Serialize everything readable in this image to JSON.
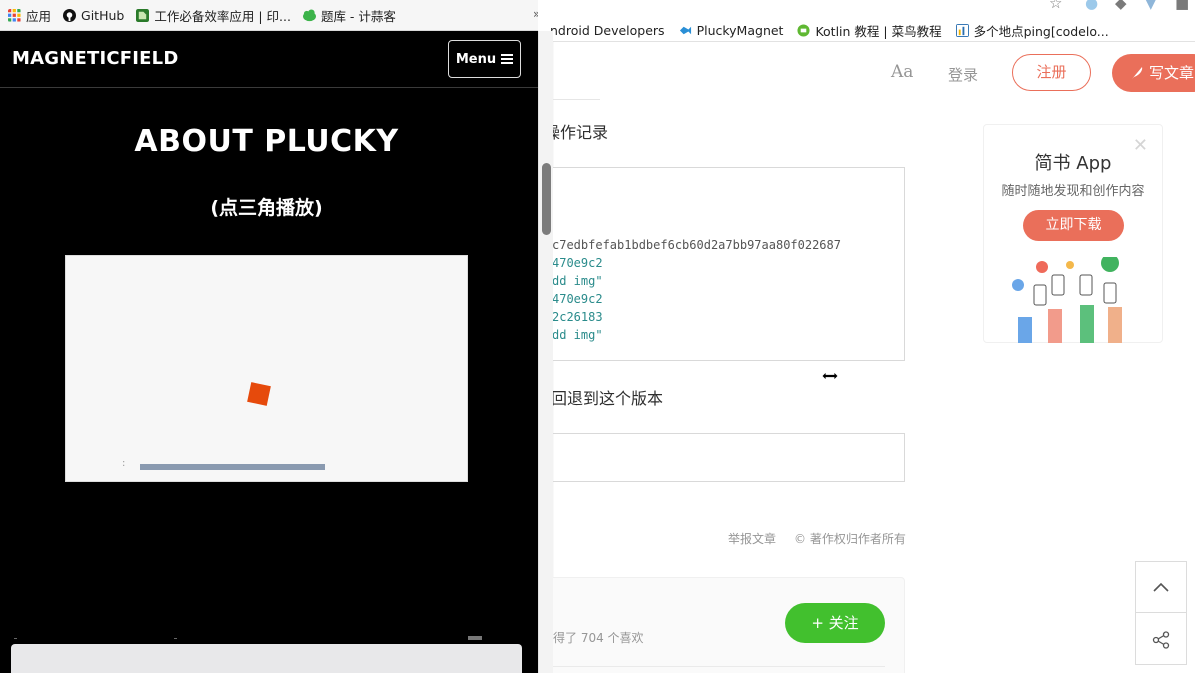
{
  "bg_browser": {
    "bookmarks": [
      {
        "label": "ndroid Developers",
        "icon": "android-icon",
        "color": "#a4c639"
      },
      {
        "label": "PluckyMagnet",
        "icon": "fish-icon",
        "color": "#2a8fd6"
      },
      {
        "label": "Kotlin 教程 | 菜鸟教程",
        "icon": "runoob-icon",
        "color": "#5fb832"
      },
      {
        "label": "多个地点ping[codelo...",
        "icon": "chart-icon",
        "color": "#2a6fb0"
      }
    ]
  },
  "jianshu": {
    "header": {
      "font_toggle": "Aa",
      "login": "登录",
      "register": "注册",
      "write": "写文章"
    },
    "section1_title": "操作记录",
    "code_lines": [
      {
        "text": "c7edbfefab1bdbef6cb60d2a7bb97aa80f022687",
        "style": "plain"
      },
      {
        "text": "470e9c2",
        "style": "green"
      },
      {
        "text": "dd img\"",
        "style": "green"
      },
      {
        "text": "470e9c2",
        "style": "green"
      },
      {
        "text": "2c26183",
        "style": "green"
      },
      {
        "text": "dd img\"",
        "style": "green"
      }
    ],
    "section2_title": "回退到这个版本",
    "report": "举报文章",
    "copyright": "© 著作权归作者所有",
    "likes": "得了 704 个喜欢",
    "follow": "+ 关注",
    "app_ad": {
      "title": "简书 App",
      "subtitle": "随时随地发现和创作内容",
      "button": "立即下载"
    }
  },
  "fg_browser": {
    "bookmarks": [
      {
        "label": "应用",
        "icon": "apps-grid-icon"
      },
      {
        "label": "GitHub",
        "icon": "github-icon"
      },
      {
        "label": "工作必备效率应用 | 印...",
        "icon": "evernote-icon"
      },
      {
        "label": "题库 - 计蒜客",
        "icon": "jisuanke-icon"
      }
    ],
    "more": "»"
  },
  "site": {
    "brand": "MAGNETICFIELD",
    "menu": "Menu",
    "title": "ABOUT PLUCKY",
    "hint": "(点三角播放)",
    "video_progress": 0.46
  },
  "colors": {
    "accent": "#ea6f5a",
    "follow": "#42c02e",
    "square": "#e64a0c"
  }
}
